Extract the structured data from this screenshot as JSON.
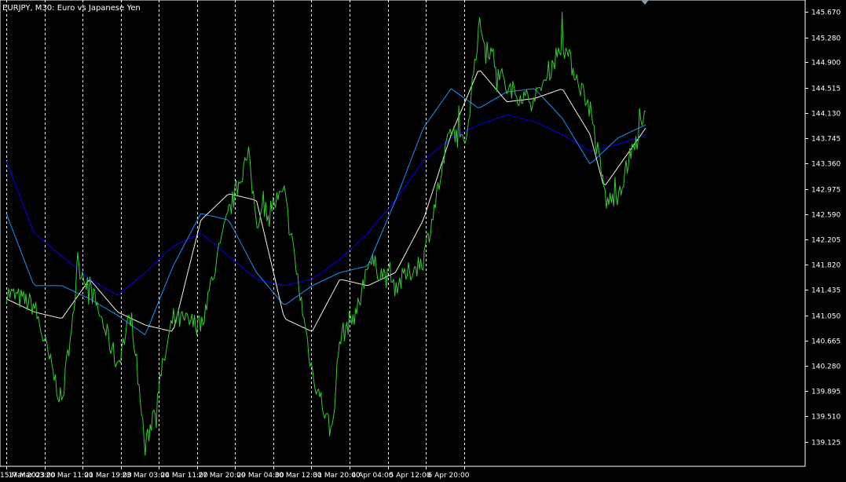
{
  "chart_title": "EURJPY, M30:  Euro vs Japanese Yen",
  "colors": {
    "background": "#000000",
    "frame": "#ffffff",
    "grid": "#ffffff",
    "price": "#32cd32",
    "ma_fast": "#f5f5dc",
    "ma_mid": "#1e90ff",
    "ma_slow": "#0000ff",
    "text": "#ffffff"
  },
  "chart_data": {
    "type": "line",
    "title": "EURJPY, M30:  Euro vs Japanese Yen",
    "x_ticks": [
      "15 Mar 2023",
      "17 Mar 03:00",
      "20 Mar 11:00",
      "21 Mar 19:00",
      "23 Mar 03:00",
      "24 Mar 11:00",
      "27 Mar 20:00",
      "29 Mar 04:00",
      "30 Mar 12:00",
      "31 Mar 20:00",
      "4 Apr 04:00",
      "5 Apr 12:00",
      "6 Apr 20:00"
    ],
    "y_ticks": [
      145.67,
      145.28,
      144.9,
      144.515,
      144.13,
      143.745,
      143.36,
      142.975,
      142.59,
      142.205,
      141.82,
      141.435,
      141.05,
      140.665,
      140.28,
      139.895,
      139.51,
      139.125
    ],
    "y_tick_labels": [
      "145.670",
      "145.280",
      "144.900",
      "144.515",
      "144.130",
      "143.745",
      "143.360",
      "142.975",
      "142.590",
      "142.205",
      "141.820",
      "141.435",
      "141.050",
      "140.665",
      "140.280",
      "139.895",
      "139.510",
      "139.125"
    ],
    "ylim": [
      138.75,
      145.85
    ],
    "x_count": 24,
    "series": [
      {
        "key": "price",
        "x": [
          0,
          1,
          2,
          2.6,
          3,
          4,
          4.5,
          5,
          6,
          7,
          8,
          8.7,
          9,
          10,
          11,
          11.7,
          12,
          12.7,
          13,
          14,
          15,
          16,
          16.5,
          17,
          18,
          19,
          20,
          21,
          21.6,
          22,
          23
        ],
        "values": [
          141.4,
          141.2,
          139.7,
          141.8,
          141.5,
          140.3,
          141.1,
          139.0,
          141.0,
          140.9,
          142.6,
          143.5,
          142.5,
          142.9,
          140.2,
          139.25,
          140.7,
          141.2,
          141.9,
          141.5,
          141.9,
          143.9,
          143.6,
          145.45,
          144.5,
          144.3,
          145.2,
          144.2,
          142.75,
          142.9,
          144.1
        ]
      },
      {
        "key": "ma_fast",
        "x": [
          0,
          1,
          2,
          3,
          4,
          5,
          6,
          7,
          8,
          9,
          10,
          11,
          12,
          13,
          14,
          15,
          16,
          17,
          18,
          19,
          20,
          21,
          21.5,
          22,
          23
        ],
        "values": [
          141.3,
          141.1,
          141.0,
          141.6,
          141.1,
          140.9,
          140.8,
          142.5,
          142.9,
          142.8,
          141.0,
          140.8,
          141.6,
          141.5,
          141.7,
          142.5,
          143.8,
          144.8,
          144.3,
          144.35,
          144.5,
          143.8,
          143.0,
          143.3,
          143.9
        ]
      },
      {
        "key": "ma_mid",
        "x": [
          0,
          1,
          2,
          3,
          4,
          5,
          6,
          7,
          8,
          9,
          10,
          11,
          12,
          13,
          14,
          15,
          16,
          17,
          18,
          19,
          20,
          21,
          22,
          23
        ],
        "values": [
          142.6,
          141.5,
          141.5,
          141.3,
          141.05,
          140.75,
          141.8,
          142.6,
          142.5,
          141.7,
          141.2,
          141.5,
          141.7,
          141.8,
          142.8,
          143.9,
          144.5,
          144.2,
          144.45,
          144.5,
          144.05,
          143.35,
          143.75,
          143.95
        ]
      },
      {
        "key": "ma_slow",
        "x": [
          0,
          1,
          2,
          3,
          4,
          5,
          6,
          7,
          8,
          9,
          10,
          11,
          12,
          13,
          14,
          15,
          16,
          17,
          18,
          19,
          20,
          21,
          22,
          23
        ],
        "values": [
          143.4,
          142.3,
          141.95,
          141.6,
          141.35,
          141.7,
          142.1,
          142.3,
          141.95,
          141.6,
          141.5,
          141.6,
          141.9,
          142.3,
          142.8,
          143.4,
          143.75,
          143.95,
          144.1,
          144.0,
          143.8,
          143.55,
          143.65,
          143.8
        ]
      }
    ],
    "grid": true,
    "grid_style": "vertical-dotted"
  }
}
